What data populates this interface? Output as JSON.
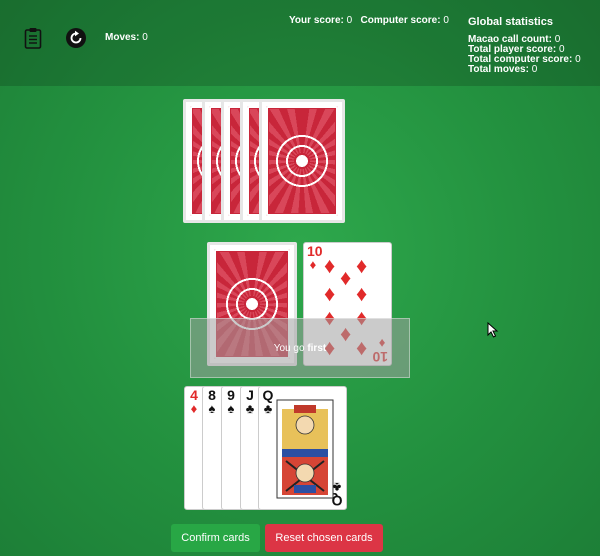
{
  "header": {
    "moves_label": "Moves:",
    "moves_value": "0",
    "your_score_label": "Your score:",
    "your_score_value": "0",
    "computer_score_label": "Computer score:",
    "computer_score_value": "0"
  },
  "global_stats": {
    "title": "Global statistics",
    "macao_label": "Macao call count:",
    "macao_value": "0",
    "player_label": "Total player score:",
    "player_value": "0",
    "computer_label": "Total computer score:",
    "computer_value": "0",
    "moves_label": "Total moves:",
    "moves_value": "0"
  },
  "table": {
    "top_card": {
      "rank": "10",
      "suit": "♦",
      "color": "#e12a2a"
    }
  },
  "overlay": {
    "text_prefix": "You go ",
    "text_bold": "first"
  },
  "hand": [
    {
      "rank": "4",
      "suit": "♦"
    },
    {
      "rank": "8",
      "suit": "♠"
    },
    {
      "rank": "9",
      "suit": "♠"
    },
    {
      "rank": "J",
      "suit": "♣"
    },
    {
      "rank": "Q",
      "suit": "♣"
    }
  ],
  "buttons": {
    "confirm": "Confirm cards",
    "reset": "Reset chosen cards"
  },
  "colors": {
    "felt": "#23913f",
    "confirm": "#28a745",
    "reset": "#dc3545",
    "card_red": "#c8263a"
  },
  "icons": {
    "rules": "clipboard-icon",
    "restart": "restart-icon",
    "cursor": "mouse-cursor-icon"
  }
}
